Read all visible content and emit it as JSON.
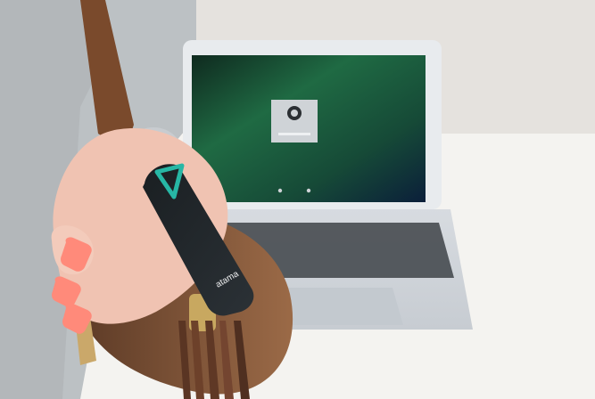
{
  "photo": {
    "keychain_brand": "atama",
    "colors": {
      "laptop_body": "#dcdfe3",
      "screen_green": "#1f6a43",
      "keychain_black": "#22272b",
      "keychain_teal": "#27b7a5",
      "bag_brown": "#8a5a3a",
      "sweater_gray": "#bfc3c6",
      "skin": "#f2c7b7",
      "nail_coral": "#ff8a7a",
      "brass": "#c8a860"
    }
  }
}
